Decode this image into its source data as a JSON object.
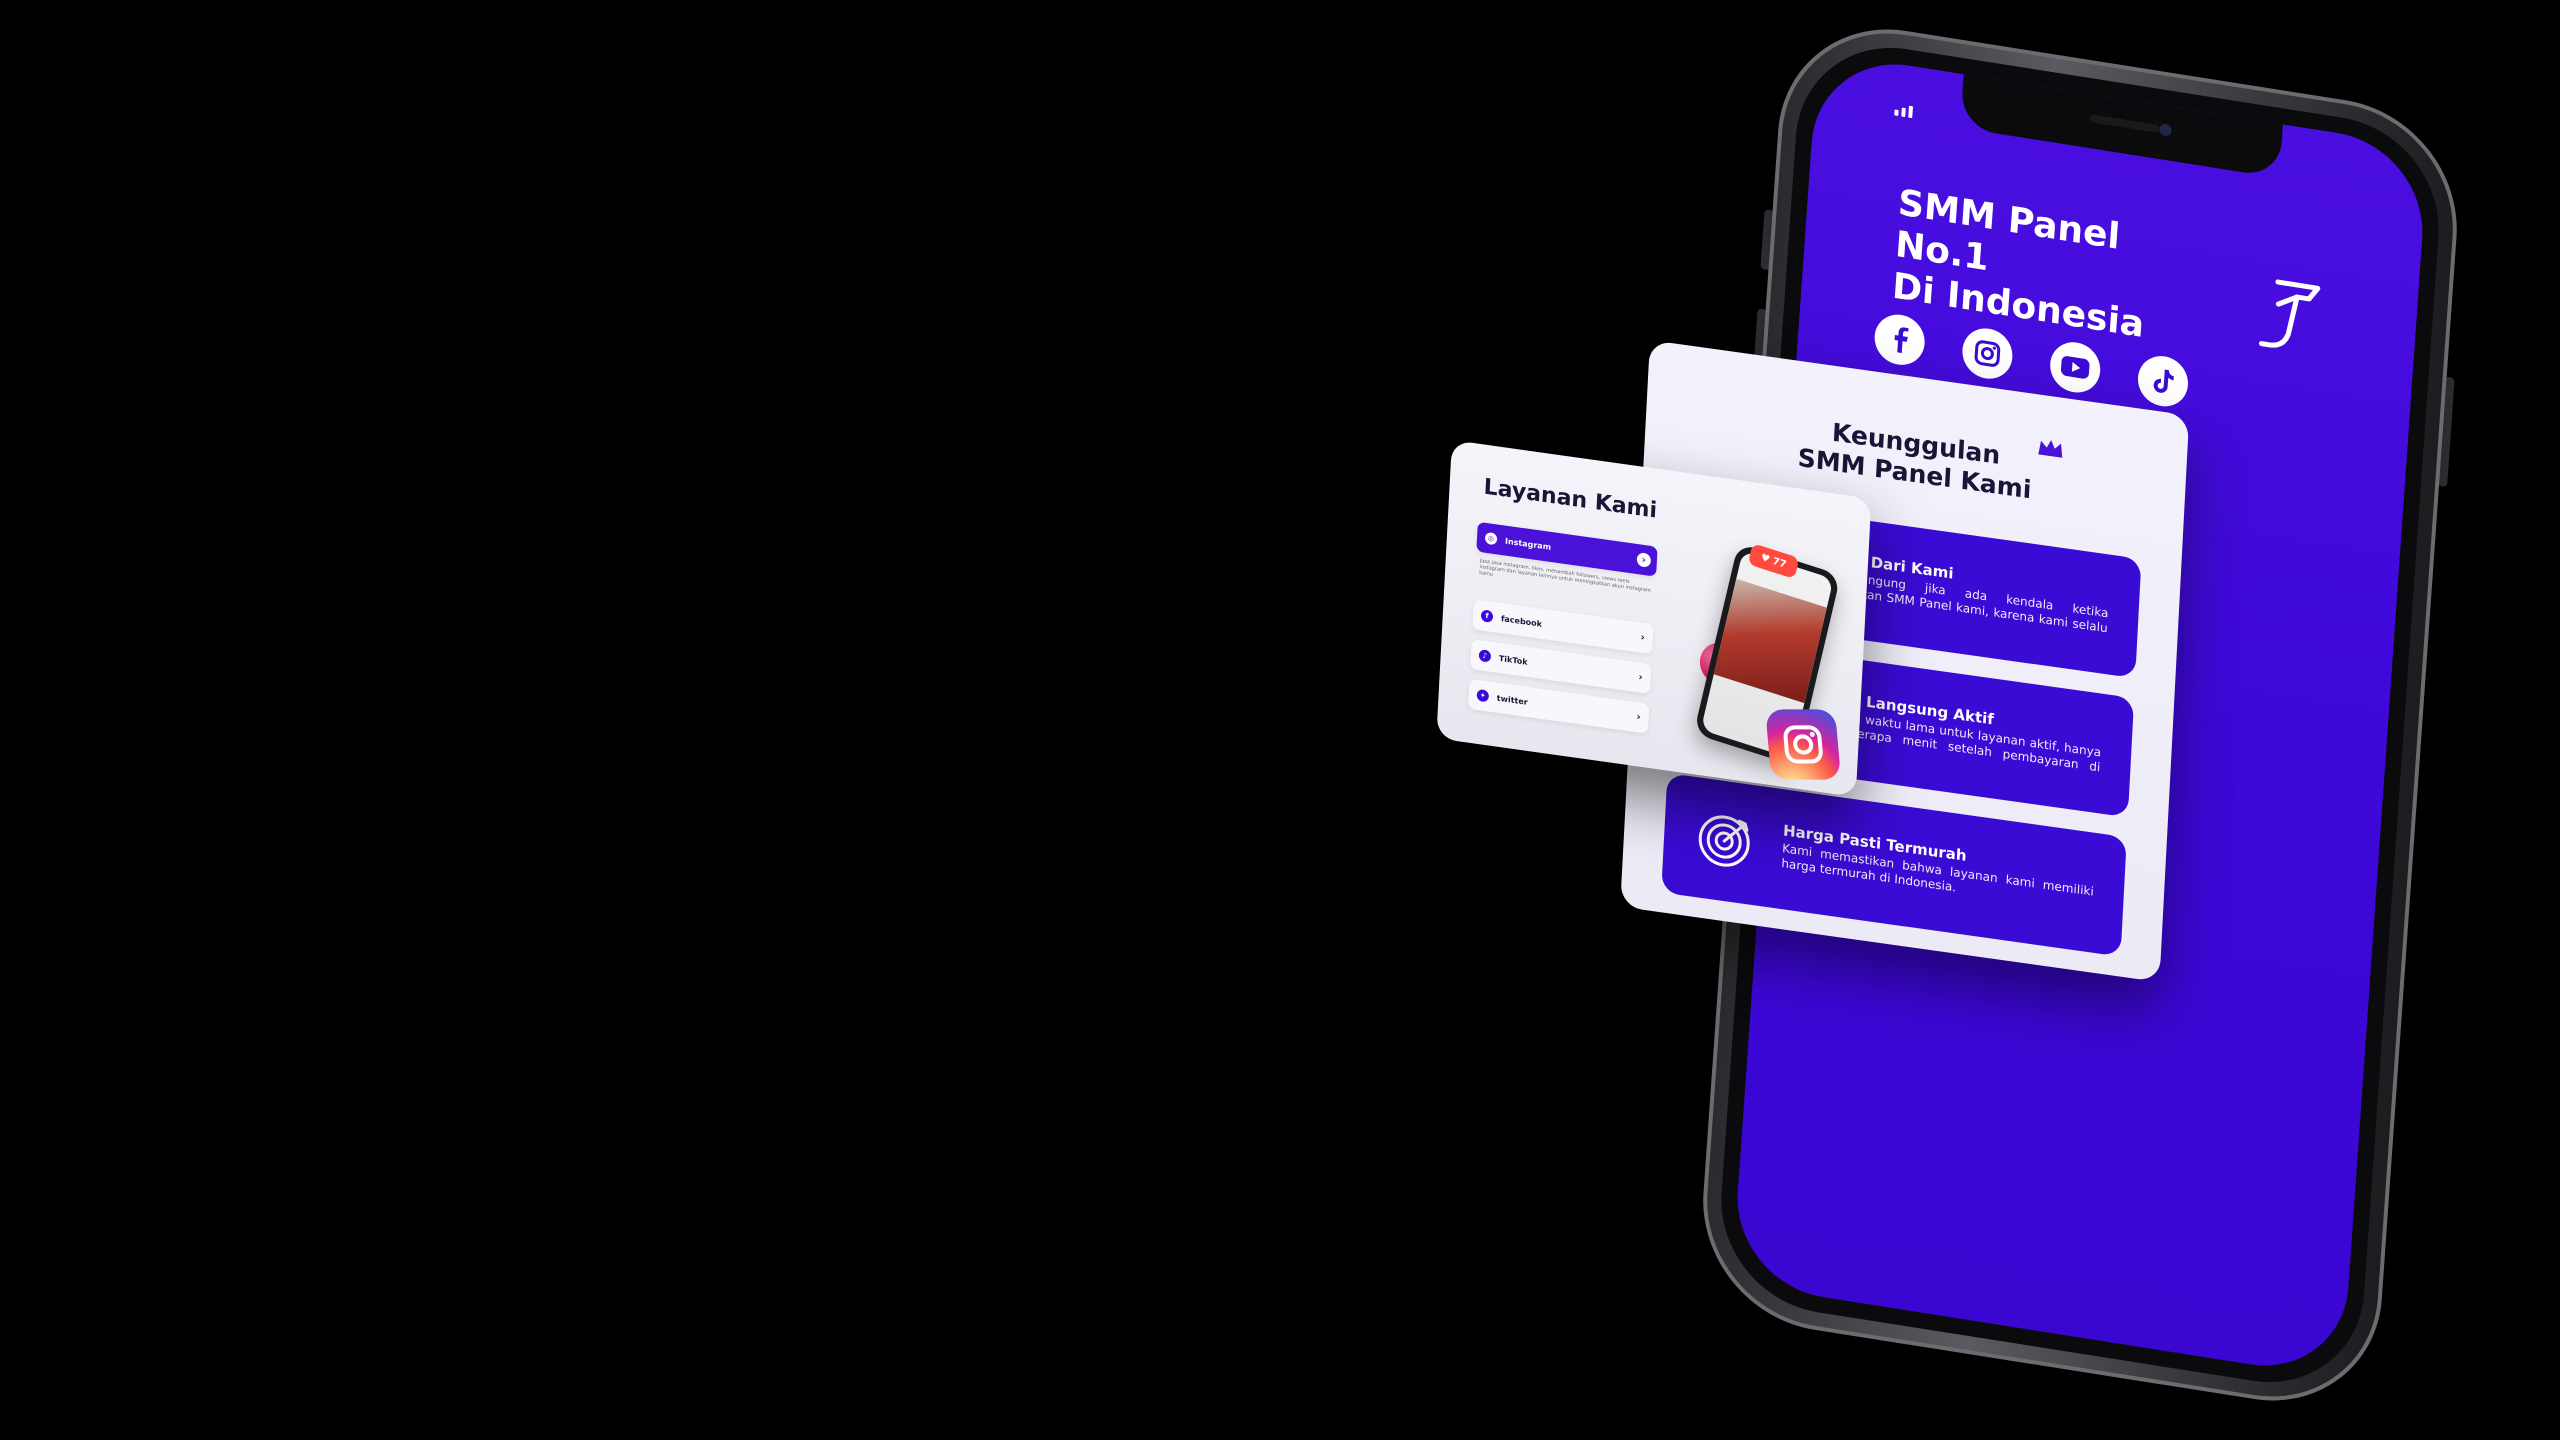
{
  "phone": {
    "hero_title_line1": "SMM Panel No.1",
    "hero_title_line2": "Di Indonesia",
    "social_icons": [
      "facebook-icon",
      "instagram-icon",
      "youtube-icon",
      "tiktok-icon"
    ],
    "brand_color": "#3d08d8"
  },
  "advantages": {
    "title_line1": "Keunggulan",
    "title_line2": "SMM Panel Kami",
    "items": [
      {
        "heading": "Support Dari Kami",
        "text": "Jangan bingung jika ada kendala ketika menggunakan SMM Panel kami, karena kami selalu membantu!",
        "icon": "support-icon"
      },
      {
        "heading": "Layanan Langsung Aktif",
        "text": "Tidak butuh waktu lama untuk layanan aktif, hanya butuh beberapa menit setelah pembayaran di konfirmasi",
        "icon": "lightning-icon"
      },
      {
        "heading": "Harga Pasti Termurah",
        "text": "Kami memastikan bahwa layanan kami memiliki harga termurah di Indonesia.",
        "icon": "target-icon"
      }
    ]
  },
  "services": {
    "title": "Layanan Kami",
    "items": [
      {
        "label": "Instagram",
        "description": "Jasa jasa instagram, likes, menambah followers, views reels instagram dan layanan lainnya untuk meningkatkan akun instagram kamu"
      },
      {
        "label": "facebook"
      },
      {
        "label": "TikTok"
      },
      {
        "label": "twitter"
      }
    ],
    "like_count": "77"
  }
}
